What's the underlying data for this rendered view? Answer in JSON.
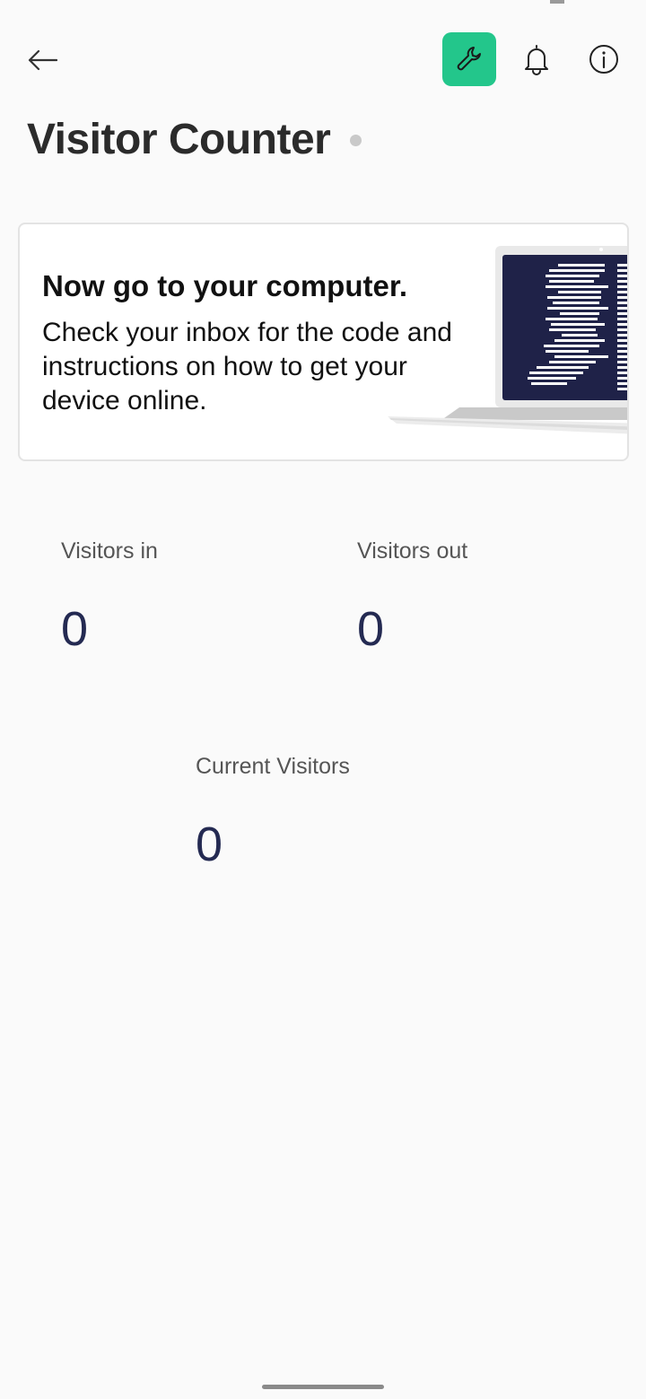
{
  "header": {
    "title": "Visitor Counter"
  },
  "card": {
    "heading": "Now go to your computer.",
    "body": "Check your inbox for the code and instructions on how to get your device online."
  },
  "stats": {
    "visitors_in": {
      "label": "Visitors in",
      "value": "0"
    },
    "visitors_out": {
      "label": "Visitors out",
      "value": "0"
    },
    "current_visitors": {
      "label": "Current Visitors",
      "value": "0"
    }
  },
  "colors": {
    "accent": "#23c68b",
    "value_text": "#242a52",
    "background": "#fafafa"
  },
  "icons": [
    "arrow-left-icon",
    "wrench-icon",
    "bell-icon",
    "info-icon",
    "laptop-illustration"
  ]
}
